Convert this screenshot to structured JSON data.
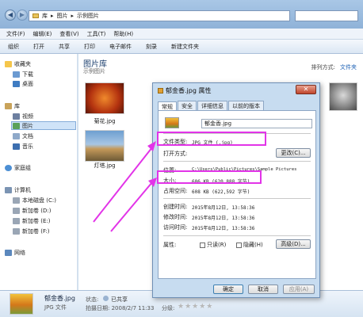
{
  "explorer": {
    "breadcrumb": [
      "库",
      "图片",
      "示例图片"
    ],
    "menu": [
      "文件(F)",
      "编辑(E)",
      "查看(V)",
      "工具(T)",
      "帮助(H)"
    ],
    "toolbar": [
      "组织",
      "打开",
      "共享",
      "打印",
      "电子邮件",
      "刻录",
      "新建文件夹"
    ],
    "nav": {
      "favorites": "收藏夹",
      "downloads": "下载",
      "desktop": "桌面",
      "libraries": "库",
      "videos": "视频",
      "pictures": "图片",
      "documents": "文档",
      "music": "音乐",
      "homegroup": "家庭组",
      "computer": "计算机",
      "local_disk": "本地磁盘 (C:)",
      "vol_d": "新加卷 (D:)",
      "vol_e": "新加卷 (E:)",
      "vol_f": "新加卷 (F:)",
      "network": "网络"
    },
    "library_title": "图片库",
    "library_sub": "示例图片",
    "arrange_label": "排列方式:",
    "arrange_value": "文件夹",
    "thumbs": [
      {
        "caption": "菊花.jpg"
      },
      {
        "caption": "灯塔.jpg"
      }
    ],
    "details": {
      "filename": "郁金香.jpg",
      "type": "JPG 文件",
      "state_label": "状态:",
      "state_value": "已共享",
      "date_label": "拍摄日期: 2008/2/7 11:33",
      "rating_label": "分级:"
    }
  },
  "dialog": {
    "title": "郁金香.jpg 属性",
    "close": "✕",
    "tabs": [
      "常规",
      "安全",
      "详细信息",
      "以前的版本"
    ],
    "filename": "郁金香.jpg",
    "file_type_label": "文件类型:",
    "file_type_value": "JPG 文件 (.jpg)",
    "open_with_label": "打开方式:",
    "change_button": "更改(C)...",
    "location_label": "位置:",
    "location_value": "C:\\Users\\Public\\Pictures\\Sample Pictures",
    "size_label": "大小:",
    "size_value": "606 KB (620,888 字节)",
    "disk_size_label": "占用空间:",
    "disk_size_value": "608 KB (622,592 字节)",
    "created_label": "创建时间:",
    "created_value": "2015年8月12日, 13:58:36",
    "modified_label": "修改时间:",
    "modified_value": "2015年8月12日, 13:58:36",
    "accessed_label": "访问时间:",
    "accessed_value": "2015年8月12日, 13:58:36",
    "attributes_label": "属性:",
    "readonly_label": "只读(R)",
    "hidden_label": "隐藏(H)",
    "advanced_button": "高级(D)...",
    "ok_button": "确定",
    "cancel_button": "取消",
    "apply_button": "应用(A)"
  },
  "colors": {
    "highlight": "#e234e8",
    "link": "#1a5fb4"
  }
}
